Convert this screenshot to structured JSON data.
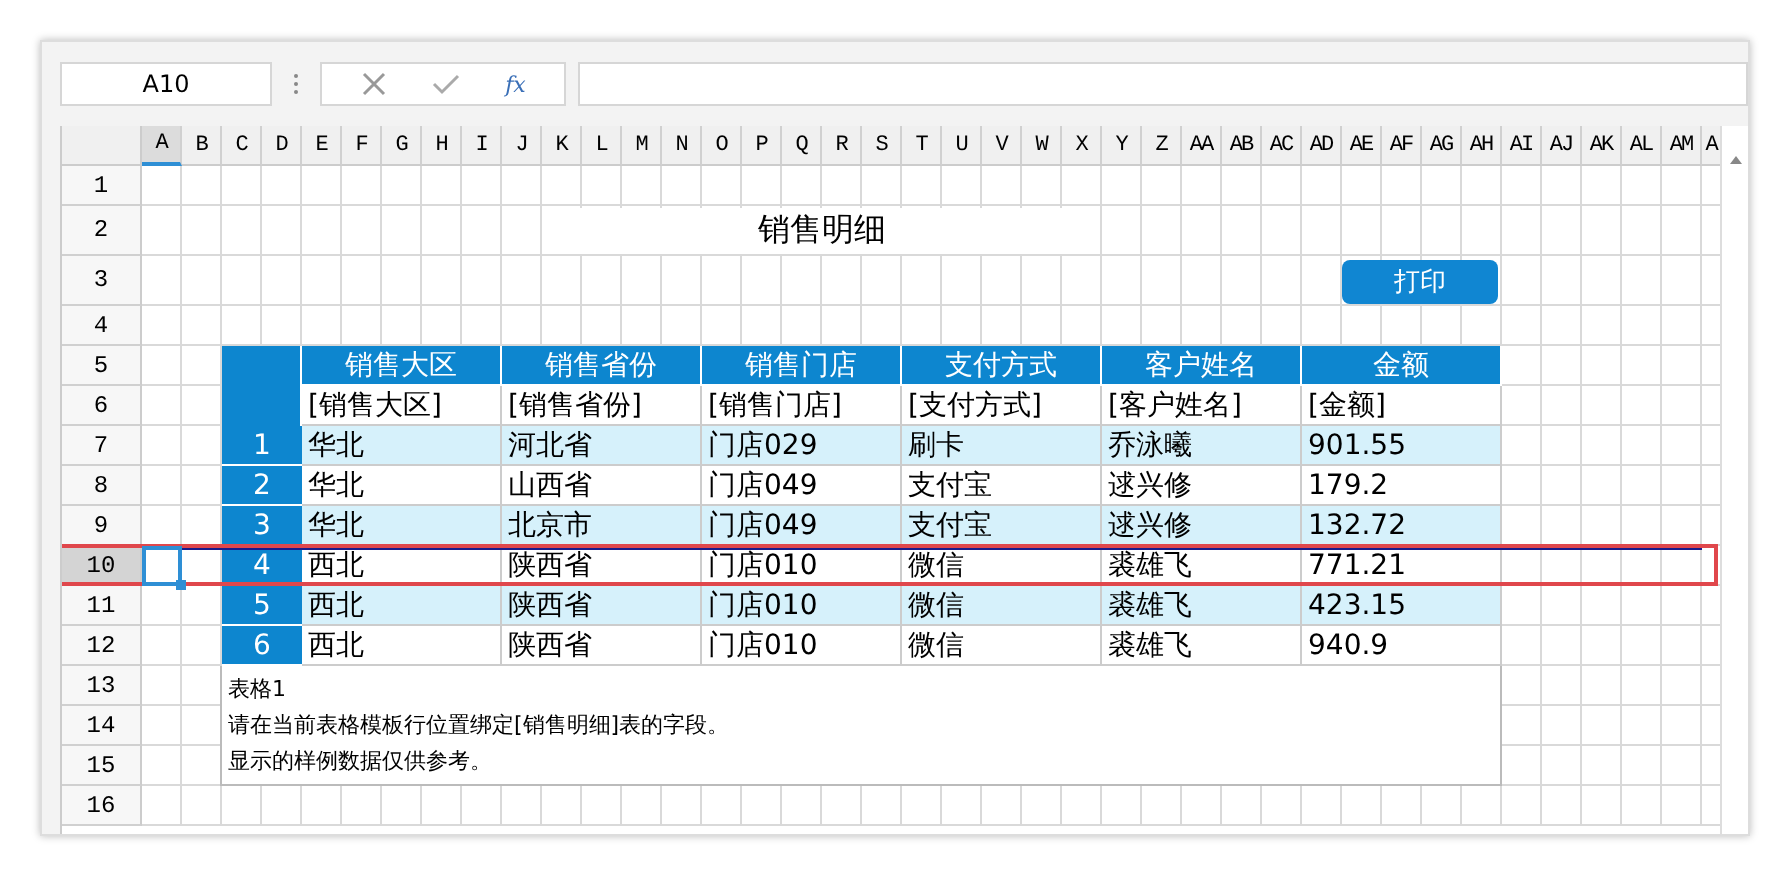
{
  "name_box": {
    "value": "A10"
  },
  "formula_bar": {
    "function_label": "fx"
  },
  "column_headers": [
    {
      "label": "A",
      "selected": true
    },
    {
      "label": "B",
      "selected": false
    },
    {
      "label": "C",
      "selected": false
    },
    {
      "label": "D",
      "selected": false
    },
    {
      "label": "E",
      "selected": false
    },
    {
      "label": "F",
      "selected": false
    },
    {
      "label": "G",
      "selected": false
    },
    {
      "label": "H",
      "selected": false
    },
    {
      "label": "I",
      "selected": false
    },
    {
      "label": "J",
      "selected": false
    },
    {
      "label": "K",
      "selected": false
    },
    {
      "label": "L",
      "selected": false
    },
    {
      "label": "M",
      "selected": false
    },
    {
      "label": "N",
      "selected": false
    },
    {
      "label": "O",
      "selected": false
    },
    {
      "label": "P",
      "selected": false
    },
    {
      "label": "Q",
      "selected": false
    },
    {
      "label": "R",
      "selected": false
    },
    {
      "label": "S",
      "selected": false
    },
    {
      "label": "T",
      "selected": false
    },
    {
      "label": "U",
      "selected": false
    },
    {
      "label": "V",
      "selected": false
    },
    {
      "label": "W",
      "selected": false
    },
    {
      "label": "X",
      "selected": false
    },
    {
      "label": "Y",
      "selected": false
    },
    {
      "label": "Z",
      "selected": false
    },
    {
      "label": "AA",
      "selected": false
    },
    {
      "label": "AB",
      "selected": false
    },
    {
      "label": "AC",
      "selected": false
    },
    {
      "label": "AD",
      "selected": false
    },
    {
      "label": "AE",
      "selected": false
    },
    {
      "label": "AF",
      "selected": false
    },
    {
      "label": "AG",
      "selected": false
    },
    {
      "label": "AH",
      "selected": false
    },
    {
      "label": "AI",
      "selected": false
    },
    {
      "label": "AJ",
      "selected": false
    },
    {
      "label": "AK",
      "selected": false
    },
    {
      "label": "AL",
      "selected": false
    },
    {
      "label": "AM",
      "selected": false
    },
    {
      "label": "A",
      "selected": false
    }
  ],
  "row_headers": [
    {
      "label": "1",
      "selected": false
    },
    {
      "label": "2",
      "selected": false
    },
    {
      "label": "3",
      "selected": false
    },
    {
      "label": "4",
      "selected": false
    },
    {
      "label": "5",
      "selected": false
    },
    {
      "label": "6",
      "selected": false
    },
    {
      "label": "7",
      "selected": false
    },
    {
      "label": "8",
      "selected": false
    },
    {
      "label": "9",
      "selected": false
    },
    {
      "label": "10",
      "selected": true
    },
    {
      "label": "11",
      "selected": false
    },
    {
      "label": "12",
      "selected": false
    },
    {
      "label": "13",
      "selected": false
    },
    {
      "label": "14",
      "selected": false
    },
    {
      "label": "15",
      "selected": false
    },
    {
      "label": "16",
      "selected": false
    }
  ],
  "title": "销售明细",
  "print_button": "打印",
  "table": {
    "columns": [
      "销售大区",
      "销售省份",
      "销售门店",
      "支付方式",
      "客户姓名",
      "金额"
    ],
    "template_row": [
      "[销售大区]",
      "[销售省份]",
      "[销售门店]",
      "[支付方式]",
      "[客户姓名]",
      "[金额]"
    ],
    "rows": [
      {
        "index": "1",
        "cells": [
          "华北",
          "河北省",
          "门店029",
          "刷卡",
          "乔泳曦",
          "901.55"
        ]
      },
      {
        "index": "2",
        "cells": [
          "华北",
          "山西省",
          "门店049",
          "支付宝",
          "逑兴修",
          "179.2"
        ]
      },
      {
        "index": "3",
        "cells": [
          "华北",
          "北京市",
          "门店049",
          "支付宝",
          "逑兴修",
          "132.72"
        ]
      },
      {
        "index": "4",
        "cells": [
          "西北",
          "陕西省",
          "门店010",
          "微信",
          "裘雄飞",
          "771.21"
        ]
      },
      {
        "index": "5",
        "cells": [
          "西北",
          "陕西省",
          "门店010",
          "微信",
          "裘雄飞",
          "423.15"
        ]
      },
      {
        "index": "6",
        "cells": [
          "西北",
          "陕西省",
          "门店010",
          "微信",
          "裘雄飞",
          "940.9"
        ]
      }
    ]
  },
  "notes": [
    "表格1",
    "请在当前表格模板行位置绑定[销售明细]表的字段。",
    "显示的样例数据仅供参考。"
  ]
}
